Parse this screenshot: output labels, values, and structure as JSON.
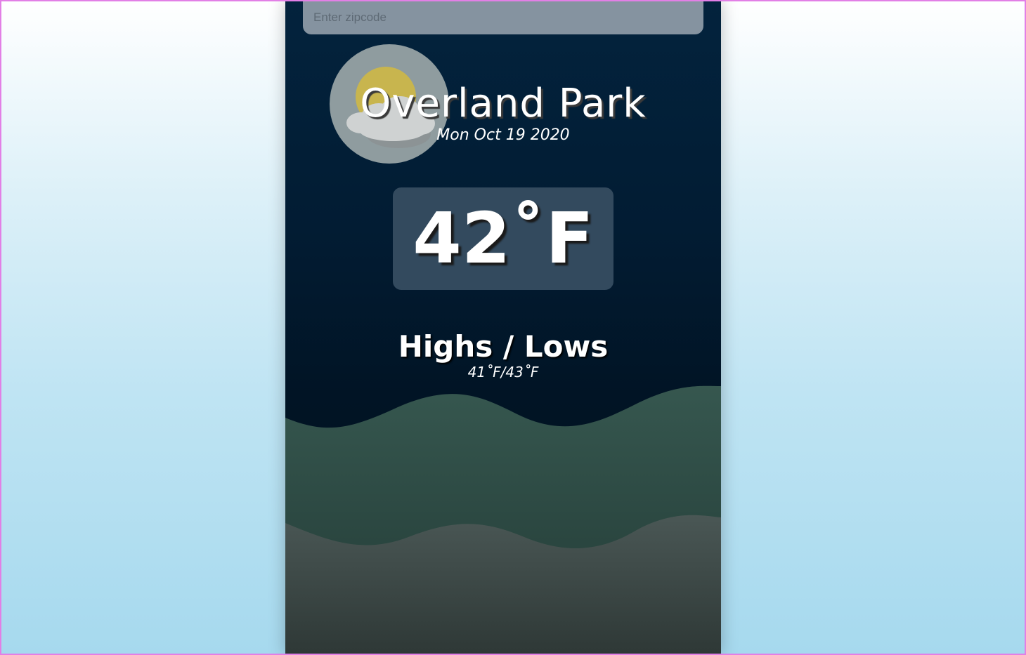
{
  "search": {
    "placeholder": "Enter zipcode",
    "value": ""
  },
  "weather": {
    "icon": "partly-cloudy-icon",
    "city": "Overland Park",
    "date": "Mon Oct 19 2020",
    "temperature": "42˚F",
    "highs_lows_title": "Highs / Lows",
    "highs_lows_value": "41˚F/43˚F"
  },
  "colors": {
    "page_background_top": "#ffffff",
    "page_background_bottom": "#a6d9ee",
    "panel_background": "#021c33",
    "input_background": "#8593a0",
    "temperature_box": "#334a5e",
    "wave_front": "#33524d",
    "wave_back": "#45504f",
    "sun": "#c8b54e",
    "cloud": "#cfd2d2",
    "frame_border": "#e27fe6"
  }
}
